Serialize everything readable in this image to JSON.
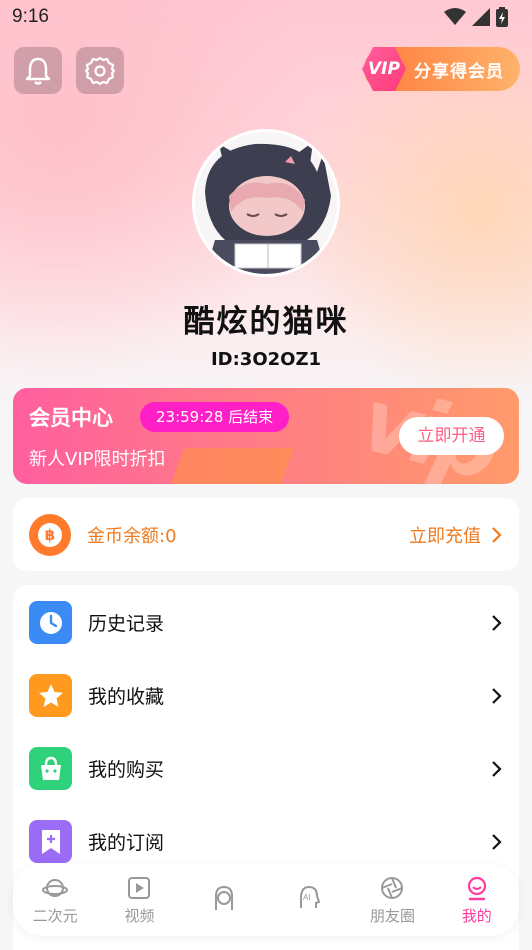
{
  "status_bar": {
    "time": "9:16"
  },
  "header": {
    "vip_badge": "VIP",
    "vip_banner_text": "分享得会员"
  },
  "profile": {
    "username": "酷炫的猫咪",
    "user_id": "ID:3O2OZ1"
  },
  "member": {
    "title": "会员中心",
    "timer": "23:59:28 后结束",
    "subtitle": "新人VIP限时折扣",
    "button": "立即开通",
    "watermark": "vip"
  },
  "coins": {
    "label": "金币余额:0",
    "action": "立即充值",
    "icon_glyph": "฿"
  },
  "menu": {
    "items": [
      {
        "label": "历史记录",
        "icon": "clock-icon",
        "color": "#3b8bf5"
      },
      {
        "label": "我的收藏",
        "icon": "star-icon",
        "color": "#ff9a1f"
      },
      {
        "label": "我的购买",
        "icon": "shopping-bag-icon",
        "color": "#2fd27a"
      },
      {
        "label": "我的订阅",
        "icon": "bookmark-icon",
        "color": "#9b6cf6"
      }
    ]
  },
  "tabbar": {
    "tabs": [
      {
        "label": "二次元",
        "icon": "planet-icon",
        "active": false
      },
      {
        "label": "视频",
        "icon": "play-icon",
        "active": false
      },
      {
        "label": "",
        "icon": "girl-avatar-icon",
        "active": false
      },
      {
        "label": "",
        "icon": "ai-face-icon",
        "active": false
      },
      {
        "label": "朋友圈",
        "icon": "aperture-icon",
        "active": false
      },
      {
        "label": "我的",
        "icon": "profile-icon",
        "active": true
      }
    ]
  },
  "colors": {
    "accent_pink": "#ff3ba0",
    "coin_orange": "#f07a1e",
    "timer_magenta": "#ff1fc7"
  }
}
